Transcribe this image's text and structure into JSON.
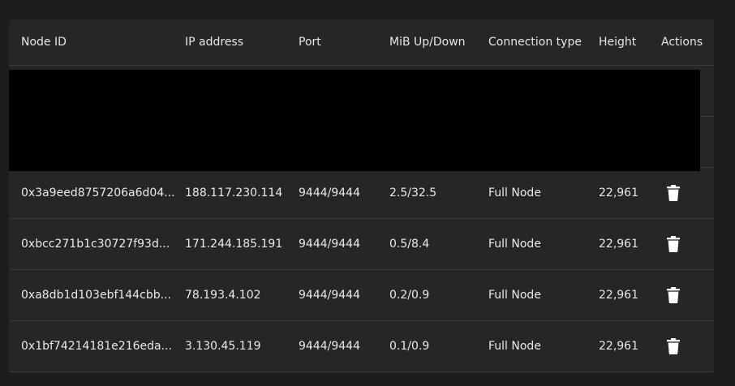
{
  "table": {
    "headers": [
      "Node ID",
      "IP address",
      "Port",
      "MiB Up/Down",
      "Connection type",
      "Height",
      "Actions"
    ],
    "rows": [
      {
        "node_id": "0x3a9eed8757206a6d04...",
        "ip": "188.117.230.114",
        "port": "9444/9444",
        "mib": "2.5/32.5",
        "type": "Full Node",
        "height": "22,961",
        "action_icon": "trash-icon"
      },
      {
        "node_id": "0xbcc271b1c30727f93d...",
        "ip": "171.244.185.191",
        "port": "9444/9444",
        "mib": "0.5/8.4",
        "type": "Full Node",
        "height": "22,961",
        "action_icon": "trash-icon"
      },
      {
        "node_id": "0xa8db1d103ebf144cbb...",
        "ip": "78.193.4.102",
        "port": "9444/9444",
        "mib": "0.2/0.9",
        "type": "Full Node",
        "height": "22,961",
        "action_icon": "trash-icon"
      },
      {
        "node_id": "0x1bf74214181e216eda...",
        "ip": "3.130.45.119",
        "port": "9444/9444",
        "mib": "0.1/0.9",
        "type": "Full Node",
        "height": "22,961",
        "action_icon": "trash-icon"
      }
    ]
  },
  "colors": {
    "background": "#1c1d1d",
    "panel": "#252626",
    "divider": "#3a3b3b",
    "text": "#eaeaea",
    "redaction": "#000000"
  }
}
